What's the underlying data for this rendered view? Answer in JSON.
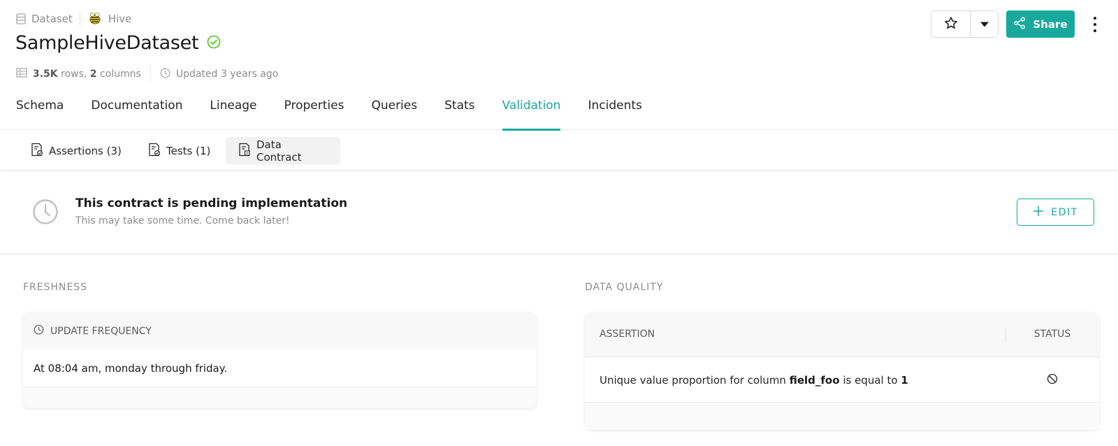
{
  "breadcrumb": {
    "entity_type": "Dataset",
    "entity_icon": "table-icon",
    "platform": "Hive",
    "platform_icon": "hive-bee-icon"
  },
  "title": "SampleHiveDataset",
  "title_status_icon": "check-circle-icon",
  "meta": {
    "rows": "3.5K",
    "rows_suffix": "rows,",
    "columns": "2",
    "columns_suffix": "columns",
    "updated": "Updated 3 years ago"
  },
  "actions": {
    "share_label": "Share"
  },
  "tabs": [
    {
      "label": "Schema",
      "active": false
    },
    {
      "label": "Documentation",
      "active": false
    },
    {
      "label": "Lineage",
      "active": false
    },
    {
      "label": "Properties",
      "active": false
    },
    {
      "label": "Queries",
      "active": false
    },
    {
      "label": "Stats",
      "active": false
    },
    {
      "label": "Validation",
      "active": true
    },
    {
      "label": "Incidents",
      "active": false
    }
  ],
  "subtabs": [
    {
      "label": "Assertions (3)",
      "icon": "assertion-doc-icon",
      "active": false
    },
    {
      "label": "Tests (1)",
      "icon": "test-doc-icon",
      "active": false
    },
    {
      "label": "Data Contract",
      "icon": "contract-doc-icon",
      "active": true
    }
  ],
  "banner": {
    "icon": "clock-icon",
    "title": "This contract is pending implementation",
    "subtitle": "This may take some time. Come back later!",
    "edit_label": "EDIT"
  },
  "freshness": {
    "section_label": "FRESHNESS",
    "header": "UPDATE FREQUENCY",
    "value": "At 08:04 am, monday through friday."
  },
  "data_quality": {
    "section_label": "DATA QUALITY",
    "columns": [
      "ASSERTION",
      "STATUS"
    ],
    "rows": [
      {
        "prefix": "Unique value proportion for column",
        "field": "field_foo",
        "middle": "is equal to",
        "value": "1",
        "status_icon": "not-run-icon"
      }
    ]
  },
  "colors": {
    "accent": "#18a99c",
    "success": "#52c41a",
    "text_muted": "#8c8c8c"
  }
}
